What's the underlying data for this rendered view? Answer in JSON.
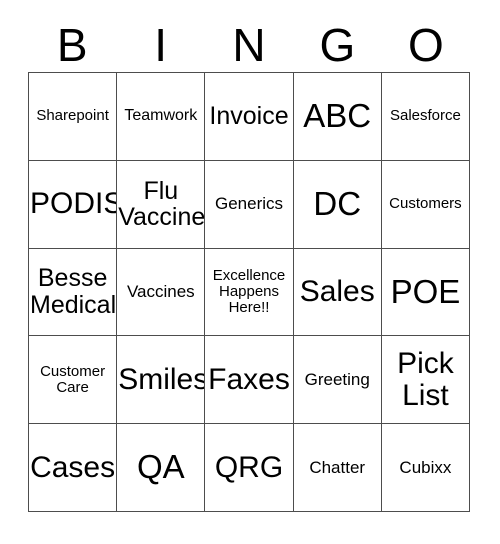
{
  "card": {
    "title": "BINGO",
    "header_letters": [
      "B",
      "I",
      "N",
      "G",
      "O"
    ],
    "rows": [
      [
        {
          "text": "Sharepoint",
          "size": "sz-s"
        },
        {
          "text": "Teamwork",
          "size": "sz-sm"
        },
        {
          "text": "Invoice",
          "size": "sz-l"
        },
        {
          "text": "ABC",
          "size": "sz-xxl"
        },
        {
          "text": "Salesforce",
          "size": "sz-s"
        }
      ],
      [
        {
          "text": "PODIS",
          "size": "sz-xl"
        },
        {
          "text": "Flu\nVaccine",
          "size": "sz-l"
        },
        {
          "text": "Generics",
          "size": "sz-m"
        },
        {
          "text": "DC",
          "size": "sz-xxl"
        },
        {
          "text": "Customers",
          "size": "sz-s"
        }
      ],
      [
        {
          "text": "Besse\nMedical",
          "size": "sz-l"
        },
        {
          "text": "Vaccines",
          "size": "sz-m"
        },
        {
          "text": "Excellence\nHappens\nHere!!",
          "size": "sz-s"
        },
        {
          "text": "Sales",
          "size": "sz-xl"
        },
        {
          "text": "POE",
          "size": "sz-xxl"
        }
      ],
      [
        {
          "text": "Customer\nCare",
          "size": "sz-s"
        },
        {
          "text": "Smiles",
          "size": "sz-xl"
        },
        {
          "text": "Faxes",
          "size": "sz-xl"
        },
        {
          "text": "Greeting",
          "size": "sz-m"
        },
        {
          "text": "Pick\nList",
          "size": "sz-xl"
        }
      ],
      [
        {
          "text": "Cases",
          "size": "sz-xl"
        },
        {
          "text": "QA",
          "size": "sz-xxl"
        },
        {
          "text": "QRG",
          "size": "sz-xl"
        },
        {
          "text": "Chatter",
          "size": "sz-m"
        },
        {
          "text": "Cubixx",
          "size": "sz-m"
        }
      ]
    ]
  },
  "colors": {
    "background": "#ffffff",
    "text": "#000000",
    "border": "#4d4d4d"
  }
}
